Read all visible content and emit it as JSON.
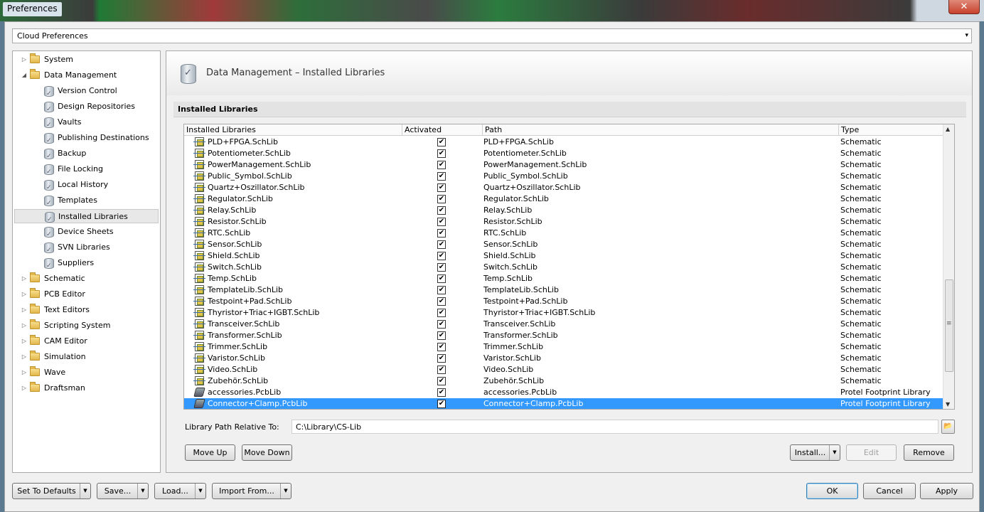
{
  "window": {
    "title": "Preferences",
    "close_glyph": "✕"
  },
  "cloud": {
    "label": "Cloud Preferences",
    "arrow": "▾"
  },
  "tree": {
    "items": [
      {
        "label": "System",
        "level": 0,
        "expander": "▷",
        "icon": "folder-icon"
      },
      {
        "label": "Data Management",
        "level": 0,
        "expander": "◢",
        "icon": "folder-icon"
      },
      {
        "label": "Version Control",
        "level": 1,
        "icon": "database-icon"
      },
      {
        "label": "Design Repositories",
        "level": 1,
        "icon": "database-icon"
      },
      {
        "label": "Vaults",
        "level": 1,
        "icon": "database-icon"
      },
      {
        "label": "Publishing Destinations",
        "level": 1,
        "icon": "database-icon"
      },
      {
        "label": "Backup",
        "level": 1,
        "icon": "database-icon"
      },
      {
        "label": "File Locking",
        "level": 1,
        "icon": "database-icon"
      },
      {
        "label": "Local History",
        "level": 1,
        "icon": "database-icon"
      },
      {
        "label": "Templates",
        "level": 1,
        "icon": "database-icon"
      },
      {
        "label": "Installed Libraries",
        "level": 1,
        "icon": "database-icon",
        "selected": true
      },
      {
        "label": "Device Sheets",
        "level": 1,
        "icon": "database-icon"
      },
      {
        "label": "SVN Libraries",
        "level": 1,
        "icon": "database-icon"
      },
      {
        "label": "Suppliers",
        "level": 1,
        "icon": "database-icon"
      },
      {
        "label": "Schematic",
        "level": 0,
        "expander": "▷",
        "icon": "folder-icon"
      },
      {
        "label": "PCB Editor",
        "level": 0,
        "expander": "▷",
        "icon": "folder-icon"
      },
      {
        "label": "Text Editors",
        "level": 0,
        "expander": "▷",
        "icon": "folder-icon"
      },
      {
        "label": "Scripting System",
        "level": 0,
        "expander": "▷",
        "icon": "folder-icon"
      },
      {
        "label": "CAM Editor",
        "level": 0,
        "expander": "▷",
        "icon": "folder-icon"
      },
      {
        "label": "Simulation",
        "level": 0,
        "expander": "▷",
        "icon": "folder-icon"
      },
      {
        "label": "Wave",
        "level": 0,
        "expander": "▷",
        "icon": "folder-icon"
      },
      {
        "label": "Draftsman",
        "level": 0,
        "expander": "▷",
        "icon": "folder-icon"
      }
    ]
  },
  "panel": {
    "title": "Data Management – Installed Libraries",
    "section": "Installed Libraries",
    "columns": [
      "Installed Libraries",
      "Activated",
      "Path",
      "Type"
    ],
    "rows": [
      {
        "name": "PLD+FPGA.SchLib",
        "activated": true,
        "path": "PLD+FPGA.SchLib",
        "type": "Schematic",
        "kind": "sch"
      },
      {
        "name": "Potentiometer.SchLib",
        "activated": true,
        "path": "Potentiometer.SchLib",
        "type": "Schematic",
        "kind": "sch"
      },
      {
        "name": "PowerManagement.SchLib",
        "activated": true,
        "path": "PowerManagement.SchLib",
        "type": "Schematic",
        "kind": "sch"
      },
      {
        "name": "Public_Symbol.SchLib",
        "activated": true,
        "path": "Public_Symbol.SchLib",
        "type": "Schematic",
        "kind": "sch"
      },
      {
        "name": "Quartz+Oszillator.SchLib",
        "activated": true,
        "path": "Quartz+Oszillator.SchLib",
        "type": "Schematic",
        "kind": "sch"
      },
      {
        "name": "Regulator.SchLib",
        "activated": true,
        "path": "Regulator.SchLib",
        "type": "Schematic",
        "kind": "sch"
      },
      {
        "name": "Relay.SchLib",
        "activated": true,
        "path": "Relay.SchLib",
        "type": "Schematic",
        "kind": "sch"
      },
      {
        "name": "Resistor.SchLib",
        "activated": true,
        "path": "Resistor.SchLib",
        "type": "Schematic",
        "kind": "sch"
      },
      {
        "name": "RTC.SchLib",
        "activated": true,
        "path": "RTC.SchLib",
        "type": "Schematic",
        "kind": "sch"
      },
      {
        "name": "Sensor.SchLib",
        "activated": true,
        "path": "Sensor.SchLib",
        "type": "Schematic",
        "kind": "sch"
      },
      {
        "name": "Shield.SchLib",
        "activated": true,
        "path": "Shield.SchLib",
        "type": "Schematic",
        "kind": "sch"
      },
      {
        "name": "Switch.SchLib",
        "activated": true,
        "path": "Switch.SchLib",
        "type": "Schematic",
        "kind": "sch"
      },
      {
        "name": "Temp.SchLib",
        "activated": true,
        "path": "Temp.SchLib",
        "type": "Schematic",
        "kind": "sch"
      },
      {
        "name": "TemplateLib.SchLib",
        "activated": true,
        "path": "TemplateLib.SchLib",
        "type": "Schematic",
        "kind": "sch"
      },
      {
        "name": "Testpoint+Pad.SchLib",
        "activated": true,
        "path": "Testpoint+Pad.SchLib",
        "type": "Schematic",
        "kind": "sch"
      },
      {
        "name": "Thyristor+Triac+IGBT.SchLib",
        "activated": true,
        "path": "Thyristor+Triac+IGBT.SchLib",
        "type": "Schematic",
        "kind": "sch"
      },
      {
        "name": "Transceiver.SchLib",
        "activated": true,
        "path": "Transceiver.SchLib",
        "type": "Schematic",
        "kind": "sch"
      },
      {
        "name": "Transformer.SchLib",
        "activated": true,
        "path": "Transformer.SchLib",
        "type": "Schematic",
        "kind": "sch"
      },
      {
        "name": "Trimmer.SchLib",
        "activated": true,
        "path": "Trimmer.SchLib",
        "type": "Schematic",
        "kind": "sch"
      },
      {
        "name": "Varistor.SchLib",
        "activated": true,
        "path": "Varistor.SchLib",
        "type": "Schematic",
        "kind": "sch"
      },
      {
        "name": "Video.SchLib",
        "activated": true,
        "path": "Video.SchLib",
        "type": "Schematic",
        "kind": "sch"
      },
      {
        "name": "Zubehör.SchLib",
        "activated": true,
        "path": "Zubehör.SchLib",
        "type": "Schematic",
        "kind": "sch"
      },
      {
        "name": "accessories.PcbLib",
        "activated": true,
        "path": "accessories.PcbLib",
        "type": "Protel Footprint Library",
        "kind": "pcb"
      },
      {
        "name": "Connector+Clamp.PcbLib",
        "activated": true,
        "path": "Connector+Clamp.PcbLib",
        "type": "Protel Footprint Library",
        "kind": "pcb",
        "selected": true
      }
    ],
    "check_glyph": "✔",
    "path_label": "Library Path Relative To:",
    "path_value": "C:\\Library\\CS-Lib",
    "buttons": {
      "move_up": "Move Up",
      "move_down": "Move Down",
      "install": "Install...",
      "edit": "Edit",
      "remove": "Remove"
    }
  },
  "footer": {
    "set_defaults": "Set To Defaults",
    "save": "Save...",
    "load": "Load...",
    "import_from": "Import From...",
    "ok": "OK",
    "cancel": "Cancel",
    "apply": "Apply",
    "split_arrow": "▼"
  }
}
